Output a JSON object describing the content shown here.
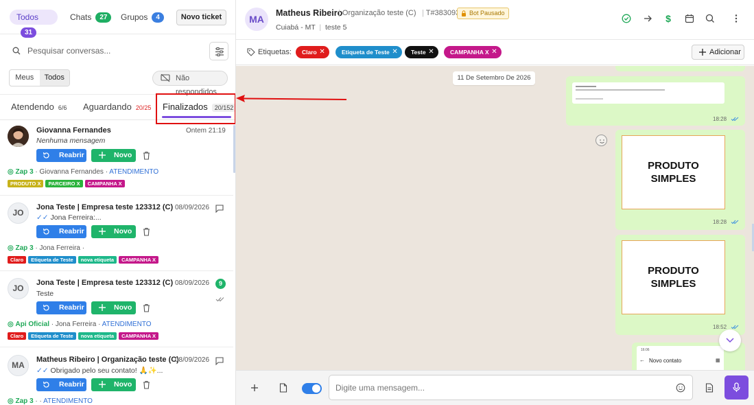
{
  "top_tabs": {
    "todos": {
      "label": "Todos",
      "count": "31"
    },
    "chats": {
      "label": "Chats",
      "count": "27"
    },
    "grupos": {
      "label": "Grupos",
      "count": "4"
    },
    "new_ticket": "Novo ticket"
  },
  "search": {
    "placeholder": "Pesquisar conversas..."
  },
  "scope": {
    "meus": "Meus",
    "todos": "Todos",
    "unanswered": "Não respondidos"
  },
  "status_tabs": {
    "atendendo": {
      "label": "Atendendo",
      "count": "6/6"
    },
    "aguardando": {
      "label": "Aguardando",
      "count": "20/25"
    },
    "finalizados": {
      "label": "Finalizados",
      "count": "20/152"
    }
  },
  "actions": {
    "reopen": "Reabrir",
    "new": "Novo"
  },
  "tickets": [
    {
      "name": "Giovanna Fernandes",
      "time": "Ontem 21:19",
      "message": "Nenhuma mensagem",
      "connection": "Zap 3",
      "contact": "· Giovanna Fernandes ·",
      "status": "ATENDIMENTO",
      "tags": [
        {
          "label": "PRODUTO X",
          "color": "#c7b21a"
        },
        {
          "label": "PARCEIRO X",
          "color": "#2bb33c"
        },
        {
          "label": "CAMPANHA X",
          "color": "#c4188a"
        }
      ]
    },
    {
      "initials": "JO",
      "name": "Jona Teste | Empresa teste 123312 (C)",
      "time": "08/09/2026",
      "message": "Jona Ferreira:...",
      "connection": "Zap 3",
      "contact": "· Jona Ferreira ·",
      "status": "",
      "tags": [
        {
          "label": "Claro",
          "color": "#e01c1c"
        },
        {
          "label": "Etiqueta de Teste",
          "color": "#1f8ecb"
        },
        {
          "label": "nova etiqueta",
          "color": "#1eb88a"
        },
        {
          "label": "CAMPANHA X",
          "color": "#c4188a"
        }
      ]
    },
    {
      "initials": "JO",
      "name": "Jona Teste | Empresa teste 123312 (C)",
      "time": "08/09/2026",
      "message": "Teste",
      "unread": "9",
      "connection": "Api Oficial",
      "contact": "· Jona Ferreira ·",
      "status": "ATENDIMENTO",
      "tags": [
        {
          "label": "Claro",
          "color": "#e01c1c"
        },
        {
          "label": "Etiqueta de Teste",
          "color": "#1f8ecb"
        },
        {
          "label": "nova etiqueta",
          "color": "#1eb88a"
        },
        {
          "label": "CAMPANHA X",
          "color": "#c4188a"
        }
      ]
    },
    {
      "initials": "MA",
      "name": "Matheus Ribeiro | Organização teste (C)",
      "time": "08/09/2026",
      "message": "Obrigado pelo seu contato! 🙏✨...",
      "connection": "Zap 3",
      "contact": "· ·",
      "status": "ATENDIMENTO"
    }
  ],
  "chat": {
    "initials": "MA",
    "name": "Matheus Ribeiro",
    "org": "Organização teste (C)",
    "ticket": "T#383093",
    "bot_badge": "Bot Pausado",
    "location": "Cuiabá - MT",
    "sub": "teste 5"
  },
  "tagbar": {
    "label": "Etiquetas:",
    "tags": [
      {
        "label": "Claro",
        "color": "#e01c1c"
      },
      {
        "label": "Etiqueta de Teste",
        "color": "#1f8ecb"
      },
      {
        "label": "Teste",
        "color": "#111111"
      },
      {
        "label": "CAMPANHA X",
        "color": "#c4188a"
      }
    ],
    "add": "Adicionar"
  },
  "messages": {
    "date": "11 De Setembro De 2026",
    "items": [
      {
        "time": "18:28"
      },
      {
        "time": "18:28",
        "card_l1": "PRODUTO",
        "card_l2": "SIMPLES"
      },
      {
        "time": "18:52",
        "card_l1": "PRODUTO",
        "card_l2": "SIMPLES"
      },
      {
        "preview_time": "16:06",
        "preview_title": "Novo contato"
      }
    ]
  },
  "composer": {
    "placeholder": "Digite uma mensagem..."
  },
  "colors": {
    "accent": "#7c4dde",
    "primary": "#2f7fe8",
    "success": "#1fb46a",
    "bubble": "#dcf8c6"
  }
}
